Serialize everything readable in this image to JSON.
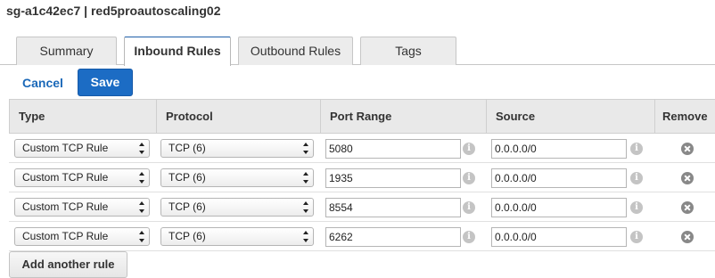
{
  "header": {
    "title": "sg-a1c42ec7 | red5proautoscaling02"
  },
  "tabs": [
    {
      "label": "Summary",
      "active": false
    },
    {
      "label": "Inbound Rules",
      "active": true
    },
    {
      "label": "Outbound Rules",
      "active": false
    },
    {
      "label": "Tags",
      "active": false
    }
  ],
  "actions": {
    "cancel_label": "Cancel",
    "save_label": "Save"
  },
  "table": {
    "columns": [
      "Type",
      "Protocol",
      "Port Range",
      "Source",
      "Remove"
    ],
    "rows": [
      {
        "type": "Custom TCP Rule",
        "protocol": "TCP (6)",
        "port_range": "5080",
        "source": "0.0.0.0/0"
      },
      {
        "type": "Custom TCP Rule",
        "protocol": "TCP (6)",
        "port_range": "1935",
        "source": "0.0.0.0/0"
      },
      {
        "type": "Custom TCP Rule",
        "protocol": "TCP (6)",
        "port_range": "8554",
        "source": "0.0.0.0/0"
      },
      {
        "type": "Custom TCP Rule",
        "protocol": "TCP (6)",
        "port_range": "6262",
        "source": "0.0.0.0/0"
      }
    ]
  },
  "icons": {
    "info": "info-icon",
    "remove": "remove-circle-icon",
    "select_arrows": "select-arrows-icon"
  },
  "add_rule_label": "Add another rule",
  "colors": {
    "accent": "#1c6cc4",
    "link": "#1a68b8",
    "header_bg": "#e9e9e9"
  }
}
